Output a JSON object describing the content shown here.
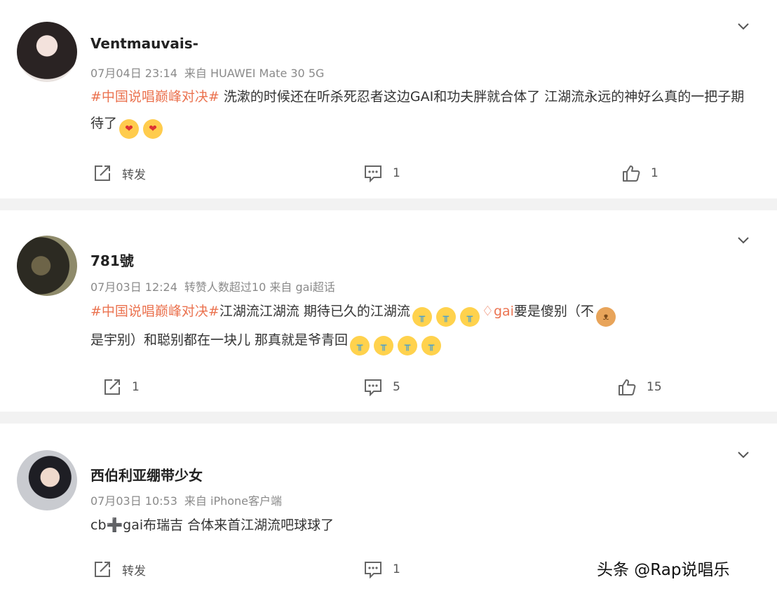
{
  "posts": [
    {
      "username": "Ventmauvais-",
      "date": "07月04日 23:14",
      "source": "来自 HUAWEI Mate 30 5G",
      "hashtag": "#中国说唱巅峰对决#",
      "text1": " 洗漱的时候还在听杀死忍者这边GAI和功夫胖就合体了 江湖流永远的神好么真的一把子期待了",
      "text2": "",
      "text3": "",
      "mention": "",
      "repost": "转发",
      "comments": "1",
      "likes": "1"
    },
    {
      "username": "781號",
      "date": "07月03日 12:24",
      "source": "转赞人数超过10 来自 gai超话",
      "hashtag": "#中国说唱巅峰对决#",
      "text1": "江湖流江湖流 期待已久的江湖流",
      "mention": "gai",
      "text2": "要是傻别（不",
      "text3": "是宇别）和聪别都在一块儿 那真就是爷青回",
      "repost": "1",
      "comments": "5",
      "likes": "15"
    },
    {
      "username": "西伯利亚绷带少女",
      "date": "07月03日 10:53",
      "source": "来自 iPhone客户端",
      "hashtag": "",
      "text1": "cb➕gai布瑞吉 合体来首江湖流吧球球了",
      "text2": "",
      "text3": "",
      "mention": "",
      "repost": "转发",
      "comments": "1",
      "likes": ""
    }
  ],
  "icons": {
    "chevron": "chevron-down-icon",
    "repost": "repost-icon",
    "comment": "comment-icon",
    "like": "thumbs-up-icon",
    "emoji_kiss": "kiss-emoji-icon",
    "emoji_cry": "crying-emoji-icon",
    "emoji_doge": "doge-emoji-icon",
    "mention_badge": "diamond-icon"
  },
  "colors": {
    "accent": "#eb7350",
    "background": "#f2f2f2",
    "card": "#ffffff"
  },
  "watermark": "头条 @Rap说唱乐"
}
